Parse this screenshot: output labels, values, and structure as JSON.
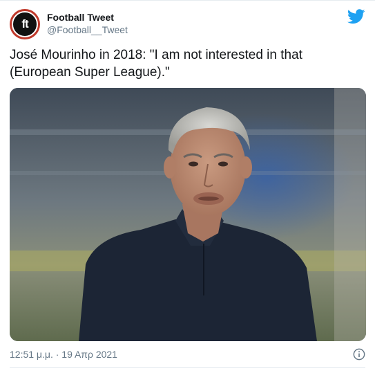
{
  "account": {
    "avatar_text": "ft",
    "avatar_icon": "ft-logo-icon",
    "display_name": "Football Tweet",
    "handle": "@Football__Tweet"
  },
  "tweet": {
    "text": "José Mourinho in 2018: \"I am not interested in that (European Super League).\"",
    "timestamp": "12:51 μ.μ. · 19 Απρ 2021"
  },
  "icons": {
    "platform": "twitter-bird-icon",
    "info": "info-icon"
  },
  "colors": {
    "brand": "#1da1f2",
    "avatar_ring": "#c0392b",
    "secondary_text": "#657786",
    "primary_text": "#14171a"
  }
}
